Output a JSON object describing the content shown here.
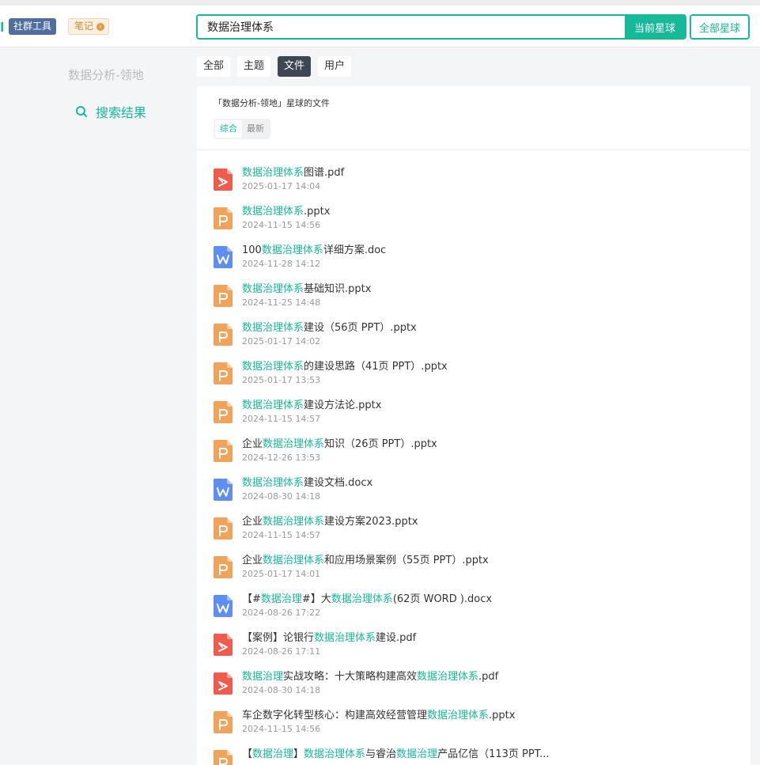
{
  "header": {
    "tag_community": "社群工具",
    "tag_notes": "笔记",
    "search_value": "数据治理体系",
    "btn_current": "当前星球",
    "btn_all": "全部星球"
  },
  "sidebar": {
    "group_name": "数据分析-领地",
    "search_result_label": "搜索结果"
  },
  "tabs": [
    {
      "label": "全部",
      "active": false
    },
    {
      "label": "主题",
      "active": false
    },
    {
      "label": "文件",
      "active": true
    },
    {
      "label": "用户",
      "active": false
    }
  ],
  "panel": {
    "subtitle": "「数据分析-领地」星球的文件",
    "sort_comprehensive": "综合",
    "sort_latest": "最新"
  },
  "files": [
    {
      "type": "pdf",
      "parts": [
        {
          "t": "数据治理体系",
          "hl": true
        },
        {
          "t": "图谱.pdf",
          "hl": false
        }
      ],
      "date": "2025-01-17 14:04"
    },
    {
      "type": "ppt",
      "parts": [
        {
          "t": "数据治理体系",
          "hl": true
        },
        {
          "t": ".pptx",
          "hl": false
        }
      ],
      "date": "2024-11-15 14:56"
    },
    {
      "type": "doc",
      "parts": [
        {
          "t": "100",
          "hl": false
        },
        {
          "t": "数据治理体系",
          "hl": true
        },
        {
          "t": "详细方案.doc",
          "hl": false
        }
      ],
      "date": "2024-11-28 14:12"
    },
    {
      "type": "ppt",
      "parts": [
        {
          "t": "数据治理体系",
          "hl": true
        },
        {
          "t": "基础知识.pptx",
          "hl": false
        }
      ],
      "date": "2024-11-25 14:48"
    },
    {
      "type": "ppt",
      "parts": [
        {
          "t": "数据治理体系",
          "hl": true
        },
        {
          "t": "建设（56页 PPT）.pptx",
          "hl": false
        }
      ],
      "date": "2025-01-17 14:02"
    },
    {
      "type": "ppt",
      "parts": [
        {
          "t": "数据治理体系",
          "hl": true
        },
        {
          "t": "的建设思路（41页 PPT）.pptx",
          "hl": false
        }
      ],
      "date": "2025-01-17 13:53"
    },
    {
      "type": "ppt",
      "parts": [
        {
          "t": "数据治理体系",
          "hl": true
        },
        {
          "t": "建设方法论.pptx",
          "hl": false
        }
      ],
      "date": "2024-11-15 14:57"
    },
    {
      "type": "ppt",
      "parts": [
        {
          "t": "企业",
          "hl": false
        },
        {
          "t": "数据治理体系",
          "hl": true
        },
        {
          "t": "知识（26页 PPT）.pptx",
          "hl": false
        }
      ],
      "date": "2024-12-26 13:53"
    },
    {
      "type": "doc",
      "parts": [
        {
          "t": "数据治理体系",
          "hl": true
        },
        {
          "t": "建设文档.docx",
          "hl": false
        }
      ],
      "date": "2024-08-30 14:18"
    },
    {
      "type": "ppt",
      "parts": [
        {
          "t": "企业",
          "hl": false
        },
        {
          "t": "数据治理体系",
          "hl": true
        },
        {
          "t": "建设方案2023.pptx",
          "hl": false
        }
      ],
      "date": "2024-11-15 14:57"
    },
    {
      "type": "ppt",
      "parts": [
        {
          "t": "企业",
          "hl": false
        },
        {
          "t": "数据治理体系",
          "hl": true
        },
        {
          "t": "和应用场景案例（55页 PPT）.pptx",
          "hl": false
        }
      ],
      "date": "2025-01-17 14:01"
    },
    {
      "type": "doc",
      "parts": [
        {
          "t": "【#",
          "hl": false
        },
        {
          "t": "数据治理",
          "hl": true
        },
        {
          "t": "#】大",
          "hl": false
        },
        {
          "t": "数据治理体系",
          "hl": true
        },
        {
          "t": "(62页 WORD ).docx",
          "hl": false
        }
      ],
      "date": "2024-08-26 17:22"
    },
    {
      "type": "pdf",
      "parts": [
        {
          "t": "【案例】论银行",
          "hl": false
        },
        {
          "t": "数据治理体系",
          "hl": true
        },
        {
          "t": "建设.pdf",
          "hl": false
        }
      ],
      "date": "2024-08-26 17:11"
    },
    {
      "type": "pdf",
      "parts": [
        {
          "t": "数据治理",
          "hl": true
        },
        {
          "t": "实战攻略：十大策略构建高效",
          "hl": false
        },
        {
          "t": "数据治理体系",
          "hl": true
        },
        {
          "t": ".pdf",
          "hl": false
        }
      ],
      "date": "2024-08-30 14:18"
    },
    {
      "type": "ppt",
      "parts": [
        {
          "t": "车企数字化转型核心：构建高效经营管理",
          "hl": false
        },
        {
          "t": "数据治理体系",
          "hl": true
        },
        {
          "t": ".pptx",
          "hl": false
        }
      ],
      "date": "2024-11-15 14:56"
    },
    {
      "type": "ppt",
      "parts": [
        {
          "t": "【",
          "hl": false
        },
        {
          "t": "数据治理",
          "hl": true
        },
        {
          "t": "】",
          "hl": false
        },
        {
          "t": "数据治理体系",
          "hl": true
        },
        {
          "t": "与睿治",
          "hl": false
        },
        {
          "t": "数据治理",
          "hl": true
        },
        {
          "t": "产品亿信（113页 PPT...",
          "hl": false
        }
      ],
      "date": ""
    }
  ],
  "colors": {
    "accent": "#16b998",
    "pdf": "#ef5b4c",
    "ppt": "#f0a35a",
    "doc": "#5f8ef2"
  }
}
